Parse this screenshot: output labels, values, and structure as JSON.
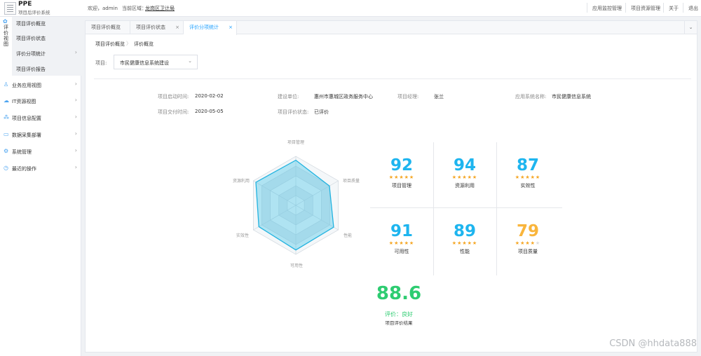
{
  "header": {
    "app_name": "PPE",
    "app_subtitle": "项目后评价系统",
    "welcome": "欢迎，admin",
    "region_label": "当前区域：",
    "region_value": "龙岗区卫计局",
    "menu": [
      "应用监控管理",
      "项目资源管理",
      "关于",
      "退出"
    ]
  },
  "sidebar": {
    "active_group": {
      "icon": "eval-icon",
      "title": "评价视图"
    },
    "sub_items": [
      {
        "label": "项目评价概览",
        "arrow": ""
      },
      {
        "label": "项目评价状态",
        "arrow": ""
      },
      {
        "label": "评价分项统计",
        "arrow": "›"
      },
      {
        "label": "项目评价报告",
        "arrow": ""
      }
    ],
    "items": [
      {
        "icon": "person-icon",
        "label": "业务应用视图",
        "arrow": "›"
      },
      {
        "icon": "cloud-icon",
        "label": "IT资源视图",
        "arrow": "›"
      },
      {
        "icon": "nodes-icon",
        "label": "项目信息配置",
        "arrow": "›"
      },
      {
        "icon": "device-icon",
        "label": "数据采集部署",
        "arrow": "›"
      },
      {
        "icon": "gear-icon",
        "label": "系统管理",
        "arrow": "›"
      },
      {
        "icon": "clock-icon",
        "label": "最近的操作",
        "arrow": "›"
      }
    ]
  },
  "tabs": [
    {
      "label": "项目评价概览",
      "closable": false
    },
    {
      "label": "项目评价状态",
      "closable": true
    },
    {
      "label": "评价分项统计",
      "closable": true,
      "active": true
    }
  ],
  "tab_close_glyph": "×",
  "tabs_menu_glyph": "⌄",
  "breadcrumb": [
    "项目评价概览",
    "评价概览"
  ],
  "breadcrumb_sep": "〉",
  "project": {
    "label": "项目:",
    "selected": "市民健康信息系统建设",
    "arrow": "⌄"
  },
  "info": {
    "start_label": "项目启动时间:",
    "start_value": "2020-02-02",
    "unit_label": "建设单位:",
    "unit_value": "惠州市惠城区政务服务中心",
    "manager_label": "项目经理:",
    "manager_value": "张兰",
    "system_label": "应用系统名称:",
    "system_value": "市民健康信息系统",
    "delivery_label": "项目交付时间:",
    "delivery_value": "2020-05-05",
    "status_label": "项目评价状态:",
    "status_value": "已评价"
  },
  "radar": {
    "axes": [
      "项目管理",
      "项目质量",
      "性能",
      "可用性",
      "实效性",
      "资源利用"
    ],
    "values": [
      92,
      79,
      89,
      91,
      87,
      94
    ],
    "max": 100
  },
  "scores": [
    {
      "value": "92",
      "stars": 4.5,
      "name": "项目管理"
    },
    {
      "value": "94",
      "stars": 5,
      "name": "资源利用"
    },
    {
      "value": "87",
      "stars": 4.5,
      "name": "实效性"
    },
    {
      "value": "91",
      "stars": 4.5,
      "name": "可用性"
    },
    {
      "value": "89",
      "stars": 4.5,
      "name": "性能"
    },
    {
      "value": "79",
      "stars": 4,
      "name": "项目质量"
    }
  ],
  "overall": {
    "value": "88.6",
    "rating": "评价：良好",
    "label": "项目评价结果"
  },
  "colors": {
    "accent": "#1e9fff",
    "score_blue": "#1eb5ef",
    "score_orange": "#f9b53c",
    "overall_green": "#2ecc71",
    "star": "#f5a623"
  },
  "watermark": "CSDN @hhdata888"
}
